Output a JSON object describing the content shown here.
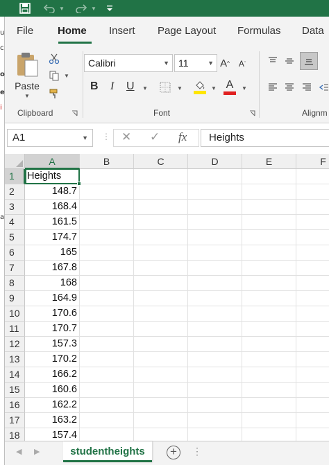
{
  "title_bar": {
    "save_icon": "save-icon",
    "undo_icon": "undo-icon",
    "redo_icon": "redo-icon",
    "customize_icon": "customize-qat-icon"
  },
  "tabs": [
    {
      "label": "File",
      "active": false
    },
    {
      "label": "Home",
      "active": true
    },
    {
      "label": "Insert",
      "active": false
    },
    {
      "label": "Page Layout",
      "active": false
    },
    {
      "label": "Formulas",
      "active": false
    },
    {
      "label": "Data",
      "active": false
    }
  ],
  "ribbon": {
    "clipboard": {
      "paste_label": "Paste",
      "group_label": "Clipboard"
    },
    "font": {
      "font_name": "Calibri",
      "font_size": "11",
      "group_label": "Font",
      "highlight_color": "#FFE600",
      "font_color": "#E02020"
    },
    "alignment": {
      "group_label": "Alignm"
    }
  },
  "formula_bar": {
    "name_box": "A1",
    "fx_label": "fx",
    "content": "Heights"
  },
  "grid": {
    "columns": [
      "A",
      "B",
      "C",
      "D",
      "E",
      "F"
    ],
    "selected_column": "A",
    "selected_row": "1",
    "rows": [
      {
        "row": "1",
        "a": "Heights"
      },
      {
        "row": "2",
        "a": "148.7"
      },
      {
        "row": "3",
        "a": "168.4"
      },
      {
        "row": "4",
        "a": "161.5"
      },
      {
        "row": "5",
        "a": "174.7"
      },
      {
        "row": "6",
        "a": "165"
      },
      {
        "row": "7",
        "a": "167.8"
      },
      {
        "row": "8",
        "a": "168"
      },
      {
        "row": "9",
        "a": "164.9"
      },
      {
        "row": "10",
        "a": "170.6"
      },
      {
        "row": "11",
        "a": "170.7"
      },
      {
        "row": "12",
        "a": "157.3"
      },
      {
        "row": "13",
        "a": "170.2"
      },
      {
        "row": "14",
        "a": "166.2"
      },
      {
        "row": "15",
        "a": "160.6"
      },
      {
        "row": "16",
        "a": "162.2"
      },
      {
        "row": "17",
        "a": "163.2"
      },
      {
        "row": "18",
        "a": "157.4"
      }
    ]
  },
  "sheets": {
    "active_sheet": "studentheights",
    "add_sheet_icon": "add-sheet-icon"
  },
  "colors": {
    "accent": "#217346",
    "ribbon_bg": "#F3F3F3"
  }
}
